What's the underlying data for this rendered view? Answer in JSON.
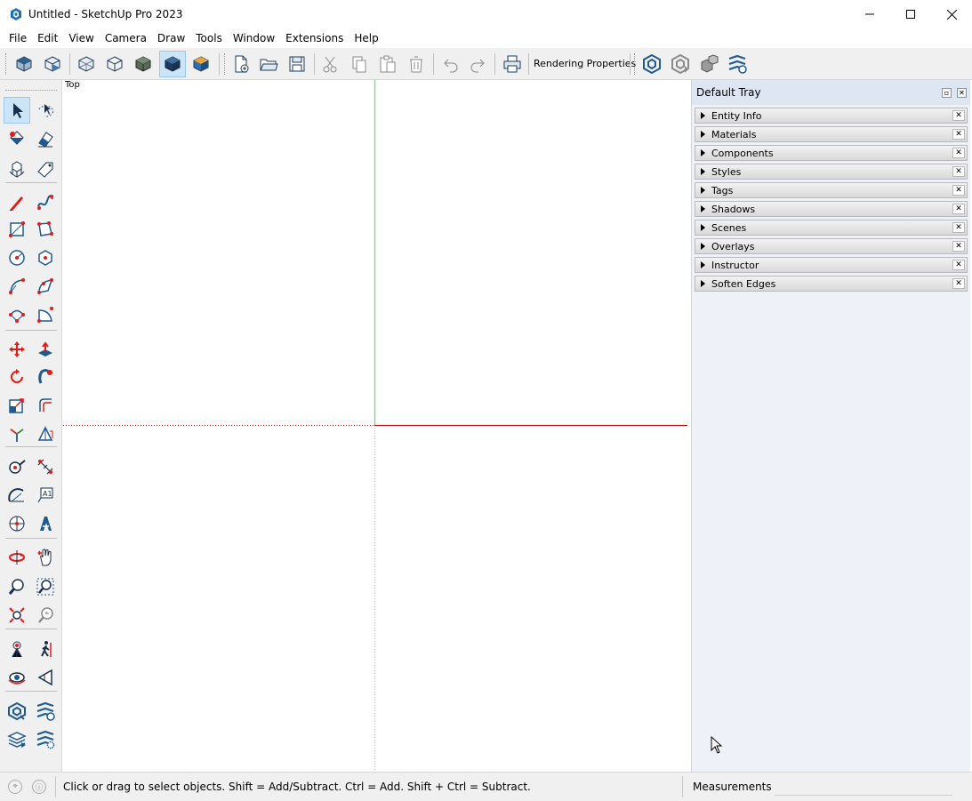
{
  "window": {
    "title": "Untitled - SketchUp Pro 2023",
    "controls": [
      "minimize",
      "maximize",
      "close"
    ]
  },
  "menu": [
    "File",
    "Edit",
    "View",
    "Camera",
    "Draw",
    "Tools",
    "Window",
    "Extensions",
    "Help"
  ],
  "toolbar": {
    "rendering_label": "Rendering Properties",
    "buttons": [
      "iso-view-icon",
      "3d-view-icon",
      "xray-style-icon",
      "wireframe-style-icon",
      "hidden-line-style-icon",
      "shaded-style-icon",
      "textured-style-icon",
      "new-file-icon",
      "open-file-icon",
      "save-file-icon",
      "cut-icon",
      "copy-icon",
      "paste-icon",
      "erase-icon",
      "undo-icon",
      "redo-icon",
      "print-icon",
      "warehouse-icon",
      "extension-warehouse-icon",
      "share-model-icon",
      "extension-manager-icon"
    ],
    "active": "shaded-style-icon"
  },
  "left_tools": [
    [
      "select-icon",
      "lasso-select-icon"
    ],
    [
      "paint-bucket-icon",
      "eraser-icon"
    ],
    [
      "make-component-icon",
      "tag-icon"
    ],
    [
      "pencil-line-icon",
      "freehand-icon"
    ],
    [
      "rectangle-icon",
      "rotated-rectangle-icon"
    ],
    [
      "circle-icon",
      "polygon-icon"
    ],
    [
      "arc-icon",
      "two-point-arc-icon"
    ],
    [
      "three-point-arc-icon",
      "pie-icon"
    ],
    [
      "move-icon",
      "push-pull-icon"
    ],
    [
      "rotate-icon",
      "follow-me-icon"
    ],
    [
      "scale-icon",
      "offset-icon"
    ],
    [
      "axes-icon",
      "section-plane-icon"
    ],
    [
      "tape-measure-icon",
      "dimension-icon"
    ],
    [
      "protractor-icon",
      "text-label-icon"
    ],
    [
      "axes-tool-icon",
      "3d-text-icon"
    ],
    [
      "orbit-icon",
      "pan-icon"
    ],
    [
      "zoom-icon",
      "zoom-window-icon"
    ],
    [
      "zoom-extents-icon",
      "previous-view-icon"
    ],
    [
      "position-camera-icon",
      "walk-icon"
    ],
    [
      "look-around-icon",
      "section-fill-icon"
    ],
    [
      "warehouse-side-icon",
      "extension-side-icon"
    ],
    [
      "layers-share-icon",
      "extension-settings-icon"
    ]
  ],
  "viewport": {
    "label": "Top"
  },
  "tray": {
    "title": "Default Tray",
    "panels": [
      "Entity Info",
      "Materials",
      "Components",
      "Styles",
      "Tags",
      "Shadows",
      "Scenes",
      "Overlays",
      "Instructor",
      "Soften Edges"
    ]
  },
  "status": {
    "message": "Click or drag to select objects. Shift = Add/Subtract. Ctrl = Add. Shift + Ctrl = Subtract.",
    "measurements_label": "Measurements",
    "measurements_value": ""
  }
}
